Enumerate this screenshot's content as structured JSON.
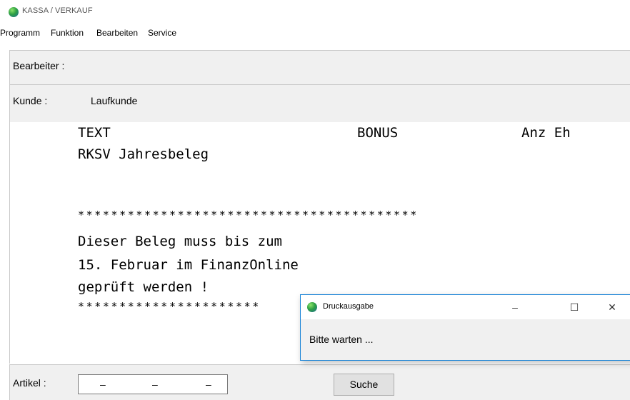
{
  "window": {
    "title": "KASSA / VERKAUF"
  },
  "menu": [
    "Programm",
    "Funktion",
    "Bearbeiten",
    "Service"
  ],
  "form": {
    "bearbeiter_label": "Bearbeiter :",
    "kunde_label": "Kunde :",
    "kunde_value": "Laufkunde"
  },
  "receipt": {
    "col_text": "TEXT",
    "col_bonus": "BONUS",
    "col_anz": "Anz Eh",
    "line1": "RKSV Jahresbeleg",
    "stars_full": "*****************************************",
    "msg1": "Dieser Beleg muss bis zum",
    "msg2": "15. Februar im FinanzOnline",
    "msg3": "geprüft werden !",
    "stars_partial": "**********************"
  },
  "bottom": {
    "artikel_label": "Artikel :",
    "artikel_segments": [
      "–",
      "–",
      "–"
    ],
    "search_button": "Suche"
  },
  "dialog": {
    "title": "Druckausgabe",
    "minimize": "–",
    "maximize": "☐",
    "close": "✕",
    "message": "Bitte warten ..."
  }
}
